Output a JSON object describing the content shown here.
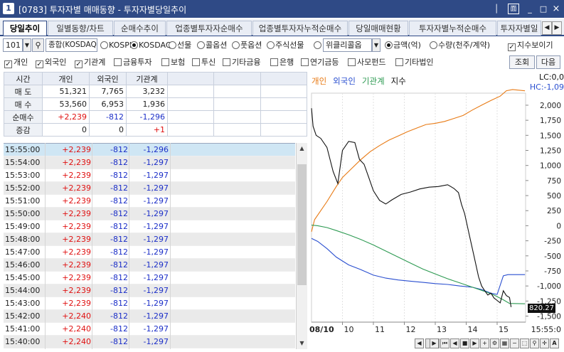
{
  "window": {
    "number": "1",
    "title": "[0783] 투자자별 매매동향 - 투자자별당일추이",
    "buttons": [
      "│",
      "面",
      "_",
      "□",
      "×"
    ]
  },
  "tabs": [
    "당일추이",
    "일별동향/차트",
    "순매수추이",
    "업종별투자자순매수",
    "업종별투자자누적순매수",
    "당일매매현황",
    "투자자별누적순매수",
    "투자자별일"
  ],
  "tab_nav": [
    "◀",
    "▶"
  ],
  "controls": {
    "code": "101",
    "market_label": "종합(KOSDAQ",
    "markets": [
      {
        "label": "KOSPI",
        "on": false
      },
      {
        "label": "KOSDAQ",
        "on": true
      },
      {
        "label": "선물",
        "on": false
      },
      {
        "label": "콜옵션",
        "on": false
      },
      {
        "label": "풋옵션",
        "on": false
      },
      {
        "label": "주식선물",
        "on": false
      }
    ],
    "weekly_option": "위클리콜옵",
    "units": [
      {
        "label": "금액(억)",
        "on": true
      },
      {
        "label": "수량(천주/계약)",
        "on": false
      }
    ],
    "index_show": "지수보이기",
    "investors": [
      {
        "label": "개인",
        "on": true
      },
      {
        "label": "외국인",
        "on": true
      },
      {
        "label": "기관계",
        "on": true
      },
      {
        "label": "금융투자",
        "on": false
      },
      {
        "label": "보험",
        "on": false
      },
      {
        "label": "투신",
        "on": false
      },
      {
        "label": "기타금융",
        "on": false
      },
      {
        "label": "은행",
        "on": false
      },
      {
        "label": "연기금등",
        "on": false
      },
      {
        "label": "사모펀드",
        "on": false
      },
      {
        "label": "기타법인",
        "on": false
      }
    ],
    "query_button": "조회",
    "next_button": "다음"
  },
  "summary": {
    "headers": [
      "시간",
      "개인",
      "외국인",
      "기관계"
    ],
    "rows": [
      {
        "label": "매 도",
        "values": [
          "51,321",
          "7,765",
          "3,232"
        ]
      },
      {
        "label": "매 수",
        "values": [
          "53,560",
          "6,953",
          "1,936"
        ]
      },
      {
        "label": "순매수",
        "values": [
          "+2,239",
          "-812",
          "-1,296"
        ]
      },
      {
        "label": "증감",
        "values": [
          "0",
          "0",
          "+1"
        ]
      }
    ]
  },
  "timeline": [
    {
      "time": "15:55:00",
      "ind": "+2,239",
      "for": "-812",
      "inst": "-1,296"
    },
    {
      "time": "15:54:00",
      "ind": "+2,239",
      "for": "-812",
      "inst": "-1,297"
    },
    {
      "time": "15:53:00",
      "ind": "+2,239",
      "for": "-812",
      "inst": "-1,297"
    },
    {
      "time": "15:52:00",
      "ind": "+2,239",
      "for": "-812",
      "inst": "-1,297"
    },
    {
      "time": "15:51:00",
      "ind": "+2,239",
      "for": "-812",
      "inst": "-1,297"
    },
    {
      "time": "15:50:00",
      "ind": "+2,239",
      "for": "-812",
      "inst": "-1,297"
    },
    {
      "time": "15:49:00",
      "ind": "+2,239",
      "for": "-812",
      "inst": "-1,297"
    },
    {
      "time": "15:48:00",
      "ind": "+2,239",
      "for": "-812",
      "inst": "-1,297"
    },
    {
      "time": "15:47:00",
      "ind": "+2,239",
      "for": "-812",
      "inst": "-1,297"
    },
    {
      "time": "15:46:00",
      "ind": "+2,239",
      "for": "-812",
      "inst": "-1,297"
    },
    {
      "time": "15:45:00",
      "ind": "+2,239",
      "for": "-812",
      "inst": "-1,297"
    },
    {
      "time": "15:44:00",
      "ind": "+2,239",
      "for": "-812",
      "inst": "-1,297"
    },
    {
      "time": "15:43:00",
      "ind": "+2,239",
      "for": "-812",
      "inst": "-1,297"
    },
    {
      "time": "15:42:00",
      "ind": "+2,240",
      "for": "-812",
      "inst": "-1,297"
    },
    {
      "time": "15:41:00",
      "ind": "+2,240",
      "for": "-812",
      "inst": "-1,297"
    },
    {
      "time": "15:40:00",
      "ind": "+2,240",
      "for": "-812",
      "inst": "-1,297"
    }
  ],
  "colors": {
    "positive": "#e01010",
    "negative": "#1c2fc8",
    "individual": "#e87a14",
    "foreign": "#2a4fd0",
    "institution": "#2d9a52",
    "index": "#111111"
  },
  "chart_data": {
    "type": "line",
    "legend": [
      "개인",
      "외국인",
      "기관계",
      "지수"
    ],
    "lc_label": "LC:0,0",
    "hc_label": "HC:-1,09",
    "current_index": "820.27",
    "date_label": "08/10",
    "x_ticks": [
      "10",
      "11",
      "12",
      "13",
      "14",
      "15"
    ],
    "time_label": "15:55:0",
    "y_ticks": [
      "2,000",
      "1,750",
      "1,500",
      "1,250",
      "1,000",
      "750",
      "500",
      "250",
      "0",
      "-250",
      "-500",
      "-750",
      "-1,000",
      "-1,250",
      "-1,500"
    ],
    "ylim": [
      -1600,
      2200
    ],
    "xlim": [
      9.0,
      15.92
    ],
    "series": [
      {
        "name": "개인",
        "points": [
          [
            9.0,
            -100
          ],
          [
            9.1,
            100
          ],
          [
            9.3,
            250
          ],
          [
            9.5,
            400
          ],
          [
            9.8,
            650
          ],
          [
            10.0,
            800
          ],
          [
            10.3,
            950
          ],
          [
            10.6,
            1100
          ],
          [
            10.9,
            1230
          ],
          [
            11.2,
            1330
          ],
          [
            11.5,
            1420
          ],
          [
            11.8,
            1490
          ],
          [
            12.1,
            1560
          ],
          [
            12.4,
            1620
          ],
          [
            12.7,
            1680
          ],
          [
            13.0,
            1700
          ],
          [
            13.3,
            1730
          ],
          [
            13.6,
            1780
          ],
          [
            13.9,
            1830
          ],
          [
            14.2,
            1920
          ],
          [
            14.5,
            2000
          ],
          [
            14.8,
            2080
          ],
          [
            15.1,
            2150
          ],
          [
            15.3,
            2240
          ],
          [
            15.5,
            2260
          ],
          [
            15.9,
            2239
          ]
        ]
      },
      {
        "name": "외국인",
        "points": [
          [
            9.0,
            -210
          ],
          [
            9.2,
            -260
          ],
          [
            9.5,
            -380
          ],
          [
            9.8,
            -520
          ],
          [
            10.2,
            -650
          ],
          [
            10.6,
            -730
          ],
          [
            11.0,
            -820
          ],
          [
            11.4,
            -870
          ],
          [
            11.8,
            -900
          ],
          [
            12.2,
            -920
          ],
          [
            12.6,
            -940
          ],
          [
            13.0,
            -960
          ],
          [
            13.4,
            -975
          ],
          [
            13.8,
            -1000
          ],
          [
            14.2,
            -1020
          ],
          [
            14.5,
            -1060
          ],
          [
            14.8,
            -1120
          ],
          [
            15.0,
            -1140
          ],
          [
            15.2,
            -830
          ],
          [
            15.35,
            -812
          ],
          [
            15.9,
            -812
          ]
        ]
      },
      {
        "name": "기관계",
        "points": [
          [
            9.0,
            10
          ],
          [
            9.2,
            0
          ],
          [
            9.5,
            -30
          ],
          [
            9.8,
            -80
          ],
          [
            10.2,
            -150
          ],
          [
            10.6,
            -230
          ],
          [
            11.0,
            -320
          ],
          [
            11.4,
            -420
          ],
          [
            11.8,
            -520
          ],
          [
            12.2,
            -620
          ],
          [
            12.6,
            -720
          ],
          [
            13.0,
            -800
          ],
          [
            13.4,
            -880
          ],
          [
            13.8,
            -950
          ],
          [
            14.2,
            -1020
          ],
          [
            14.6,
            -1090
          ],
          [
            14.9,
            -1150
          ],
          [
            15.2,
            -1230
          ],
          [
            15.4,
            -1290
          ],
          [
            15.9,
            -1296
          ]
        ]
      },
      {
        "name": "지수",
        "points": [
          [
            9.0,
            1950
          ],
          [
            9.05,
            1650
          ],
          [
            9.15,
            1500
          ],
          [
            9.3,
            1450
          ],
          [
            9.5,
            1300
          ],
          [
            9.7,
            900
          ],
          [
            9.85,
            700
          ],
          [
            10.0,
            1250
          ],
          [
            10.2,
            1400
          ],
          [
            10.4,
            1380
          ],
          [
            10.55,
            1100
          ],
          [
            10.7,
            1020
          ],
          [
            10.85,
            800
          ],
          [
            11.0,
            580
          ],
          [
            11.2,
            420
          ],
          [
            11.4,
            360
          ],
          [
            11.6,
            430
          ],
          [
            11.9,
            520
          ],
          [
            12.2,
            560
          ],
          [
            12.5,
            610
          ],
          [
            12.8,
            640
          ],
          [
            13.1,
            650
          ],
          [
            13.4,
            680
          ],
          [
            13.6,
            620
          ],
          [
            13.75,
            550
          ],
          [
            13.85,
            350
          ],
          [
            13.95,
            200
          ],
          [
            14.1,
            -150
          ],
          [
            14.25,
            -500
          ],
          [
            14.4,
            -850
          ],
          [
            14.5,
            -1000
          ],
          [
            14.6,
            -1080
          ],
          [
            14.7,
            -1150
          ],
          [
            14.8,
            -1120
          ],
          [
            14.9,
            -1200
          ],
          [
            15.0,
            -1240
          ],
          [
            15.1,
            -1280
          ],
          [
            15.2,
            -1080
          ],
          [
            15.3,
            -1160
          ],
          [
            15.4,
            -1190
          ],
          [
            15.45,
            -1350
          ]
        ]
      }
    ]
  }
}
